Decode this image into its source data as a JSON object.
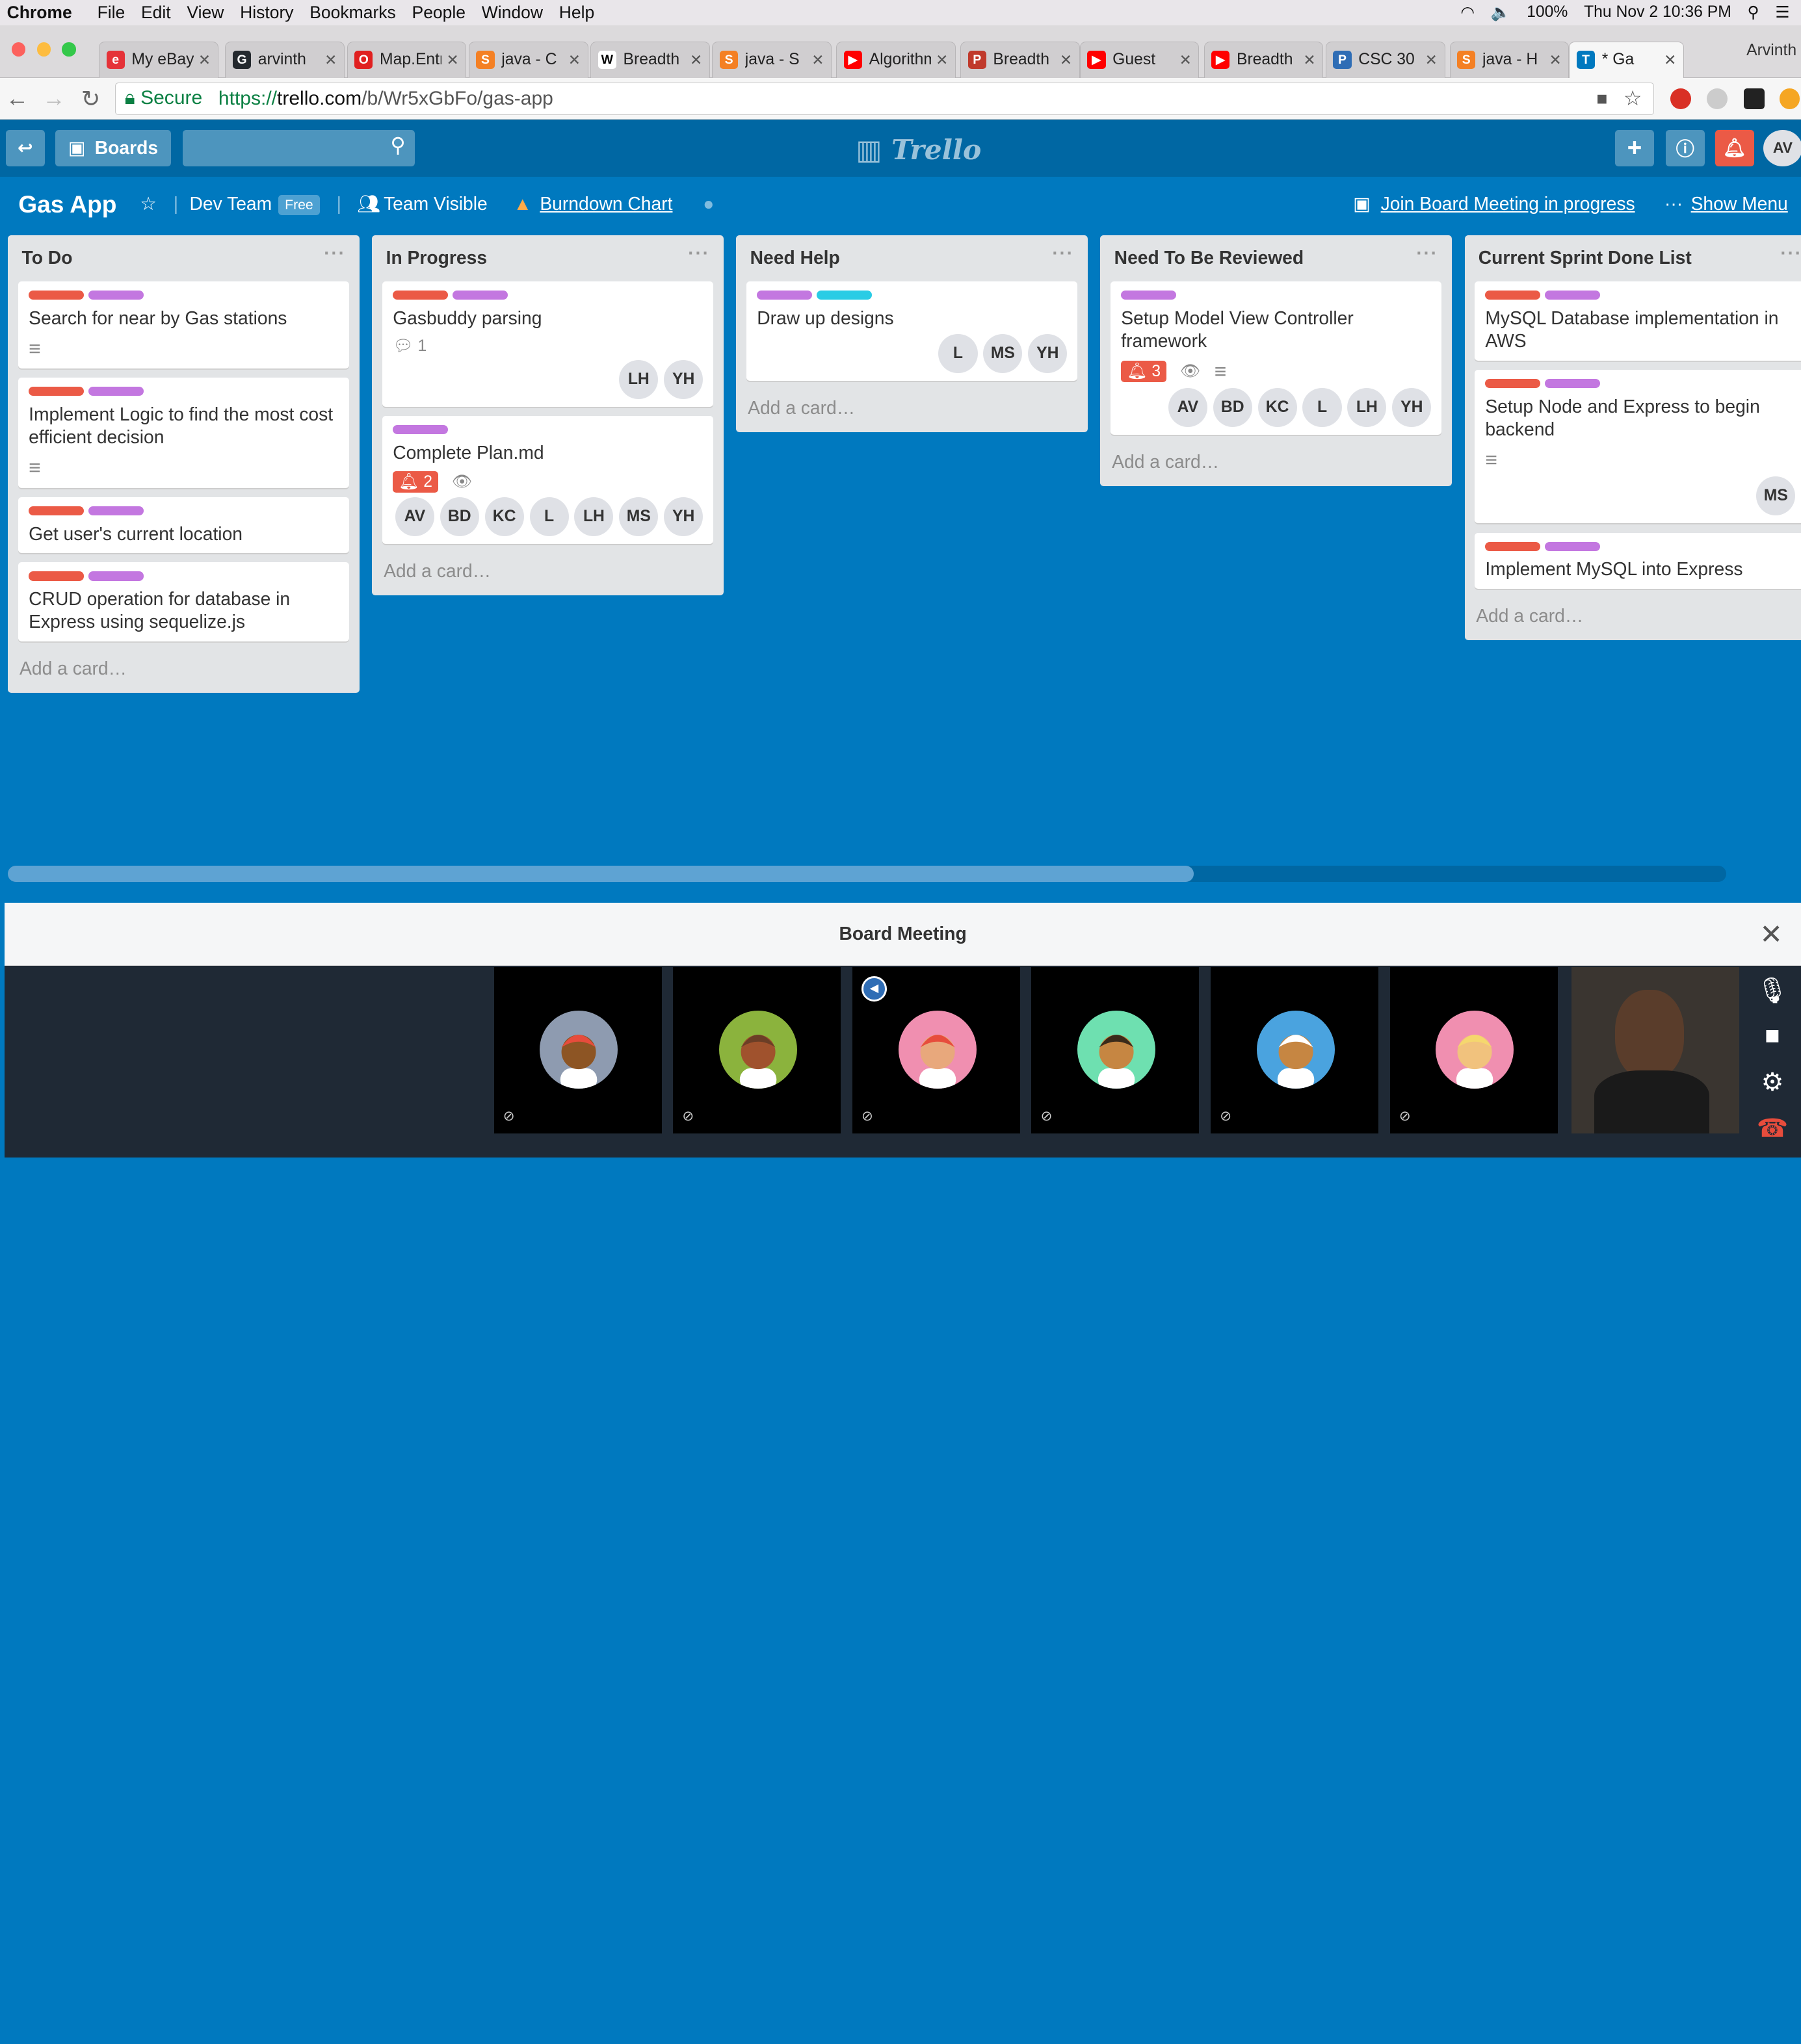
{
  "menubar": {
    "app": "Chrome",
    "items": [
      "File",
      "Edit",
      "View",
      "History",
      "Bookmarks",
      "People",
      "Window",
      "Help"
    ],
    "battery": "100%",
    "clock": "Thu Nov 2  10:36 PM"
  },
  "tabs": [
    {
      "title": "My eBay",
      "color": "#e53238",
      "glyph": "e"
    },
    {
      "title": "arvinth",
      "color": "#24292e",
      "glyph": "G"
    },
    {
      "title": "Map.Entry",
      "color": "#e02020",
      "glyph": "O"
    },
    {
      "title": "java - C",
      "color": "#f48024",
      "glyph": "S"
    },
    {
      "title": "Breadth",
      "color": "#ffffff",
      "glyph": "W"
    },
    {
      "title": "java - S",
      "color": "#f48024",
      "glyph": "S"
    },
    {
      "title": "Algorithm",
      "color": "#ff0000",
      "glyph": "▶"
    },
    {
      "title": "Breadth",
      "color": "#c0392b",
      "glyph": "P"
    },
    {
      "title": "Guest",
      "color": "#ff0000",
      "glyph": "▶"
    },
    {
      "title": "Breadth",
      "color": "#ff0000",
      "glyph": "▶"
    },
    {
      "title": "CSC 30",
      "color": "#2f6db5",
      "glyph": "P"
    },
    {
      "title": "java - H",
      "color": "#f48024",
      "glyph": "S"
    },
    {
      "title": "* Ga",
      "color": "#0079bf",
      "glyph": "T",
      "active": true
    }
  ],
  "profile_name": "Arvinth",
  "address": {
    "secure": "Secure",
    "scheme": "https://",
    "host": "trello.com",
    "path": "/b/Wr5xGbFo/gas-app"
  },
  "toolbar": {
    "boards": "Boards",
    "logo": "Trello",
    "user_initials": "AV"
  },
  "board": {
    "title": "Gas App",
    "team": "Dev Team",
    "plan": "Free",
    "visibility": "Team Visible",
    "burndown": "Burndown Chart",
    "meeting_link": "Join Board Meeting in progress",
    "show_menu": "Show Menu"
  },
  "colors": {
    "red": "#eb5a46",
    "purple": "#c377e0",
    "sky": "#29cce5",
    "board_bg": "#0079bf"
  },
  "add_card": "Add a card…",
  "lists": [
    {
      "name": "To Do",
      "cards": [
        {
          "labels": [
            "red",
            "purple"
          ],
          "title": "Search for near by Gas stations",
          "desc": true
        },
        {
          "labels": [
            "red",
            "purple"
          ],
          "title": "Implement Logic to find the most cost efficient decision",
          "desc": true
        },
        {
          "labels": [
            "red",
            "purple"
          ],
          "title": "Get user's current location"
        },
        {
          "labels": [
            "red",
            "purple"
          ],
          "title": "CRUD operation for database in Express using sequelize.js"
        }
      ]
    },
    {
      "name": "In Progress",
      "cards": [
        {
          "labels": [
            "red",
            "purple"
          ],
          "title": "Gasbuddy parsing",
          "comments": "1",
          "members": [
            "LH",
            "YH"
          ]
        },
        {
          "labels": [
            "purple"
          ],
          "title": "Complete Plan.md",
          "notif": "2",
          "watch": true,
          "members": [
            "AV",
            "BD",
            "KC",
            "L",
            "LH",
            "MS",
            "YH"
          ]
        }
      ]
    },
    {
      "name": "Need Help",
      "cards": [
        {
          "labels": [
            "purple",
            "sky"
          ],
          "title": "Draw up designs",
          "members": [
            "L",
            "MS",
            "YH"
          ]
        }
      ]
    },
    {
      "name": "Need To Be Reviewed",
      "cards": [
        {
          "labels": [
            "purple"
          ],
          "title": "Setup Model View Controller framework",
          "notif": "3",
          "watch": true,
          "desc": true,
          "members": [
            "AV",
            "BD",
            "KC",
            "L",
            "LH",
            "YH"
          ]
        }
      ]
    },
    {
      "name": "Current Sprint Done List",
      "cards": [
        {
          "labels": [
            "red",
            "purple"
          ],
          "title": "MySQL Database implementation in AWS"
        },
        {
          "labels": [
            "red",
            "purple"
          ],
          "title": "Setup Node and Express to begin backend",
          "desc": true,
          "members": [
            "MS"
          ]
        },
        {
          "labels": [
            "red",
            "purple"
          ],
          "title": "Implement MySQL into Express"
        }
      ]
    }
  ],
  "meeting": {
    "title": "Board Meeting",
    "participants": [
      {
        "bg": "#8e9bb0",
        "skin": "#8d5524",
        "hair": "#e74c3c"
      },
      {
        "bg": "#8bb33d",
        "skin": "#a0522d",
        "hair": "#6b3e26"
      },
      {
        "bg": "#f08fb0",
        "skin": "#e8a87c",
        "hair": "#e74c3c"
      },
      {
        "bg": "#6ee0b0",
        "skin": "#c68642",
        "hair": "#3a2a1a"
      },
      {
        "bg": "#4aa3df",
        "skin": "#c68642",
        "hair": "#ffffff"
      },
      {
        "bg": "#f08fb0",
        "skin": "#f1c27d",
        "hair": "#f5d76e"
      }
    ]
  }
}
